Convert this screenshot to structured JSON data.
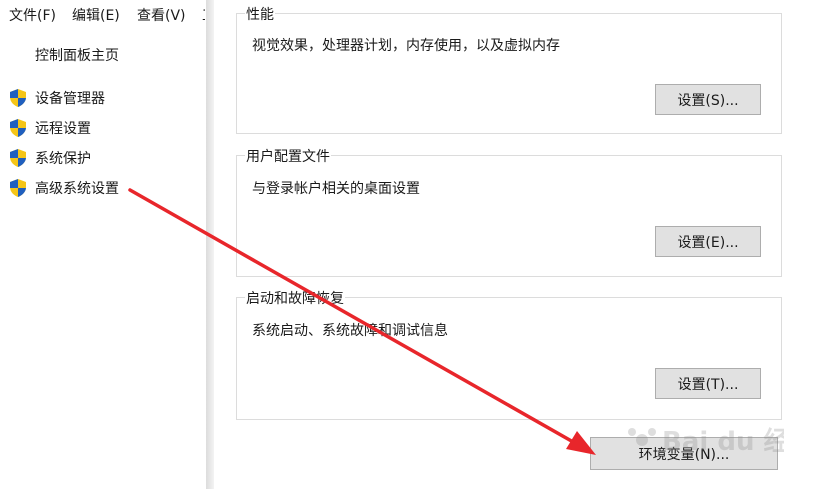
{
  "menubar": {
    "items": [
      "文件(F)",
      "编辑(E)",
      "查看(V)",
      "工"
    ]
  },
  "sidebar": {
    "home_link": "控制面板主页",
    "items": [
      {
        "label": "设备管理器",
        "icon": "uac-shield-icon"
      },
      {
        "label": "远程设置",
        "icon": "uac-shield-icon"
      },
      {
        "label": "系统保护",
        "icon": "uac-shield-icon"
      },
      {
        "label": "高级系统设置",
        "icon": "uac-shield-icon"
      }
    ]
  },
  "dialog": {
    "performance": {
      "title": "性能",
      "description": "视觉效果，处理器计划，内存使用，以及虚拟内存",
      "button": "设置(S)..."
    },
    "user_profiles": {
      "title": "用户配置文件",
      "description": "与登录帐户相关的桌面设置",
      "button": "设置(E)..."
    },
    "startup_recovery": {
      "title": "启动和故障恢复",
      "description": "系统启动、系统故障和调试信息",
      "button": "设置(T)..."
    },
    "env_button": "环境变量(N)..."
  },
  "annotation": {
    "arrow_color": "#e8262b",
    "watermark_text": "Bai du 经验"
  },
  "colors": {
    "button_bg": "#e1e1e1",
    "button_border": "#adadad",
    "group_border": "#dcdcdc",
    "shield_blue": "#1f5fbf",
    "shield_yellow": "#f5c518"
  }
}
